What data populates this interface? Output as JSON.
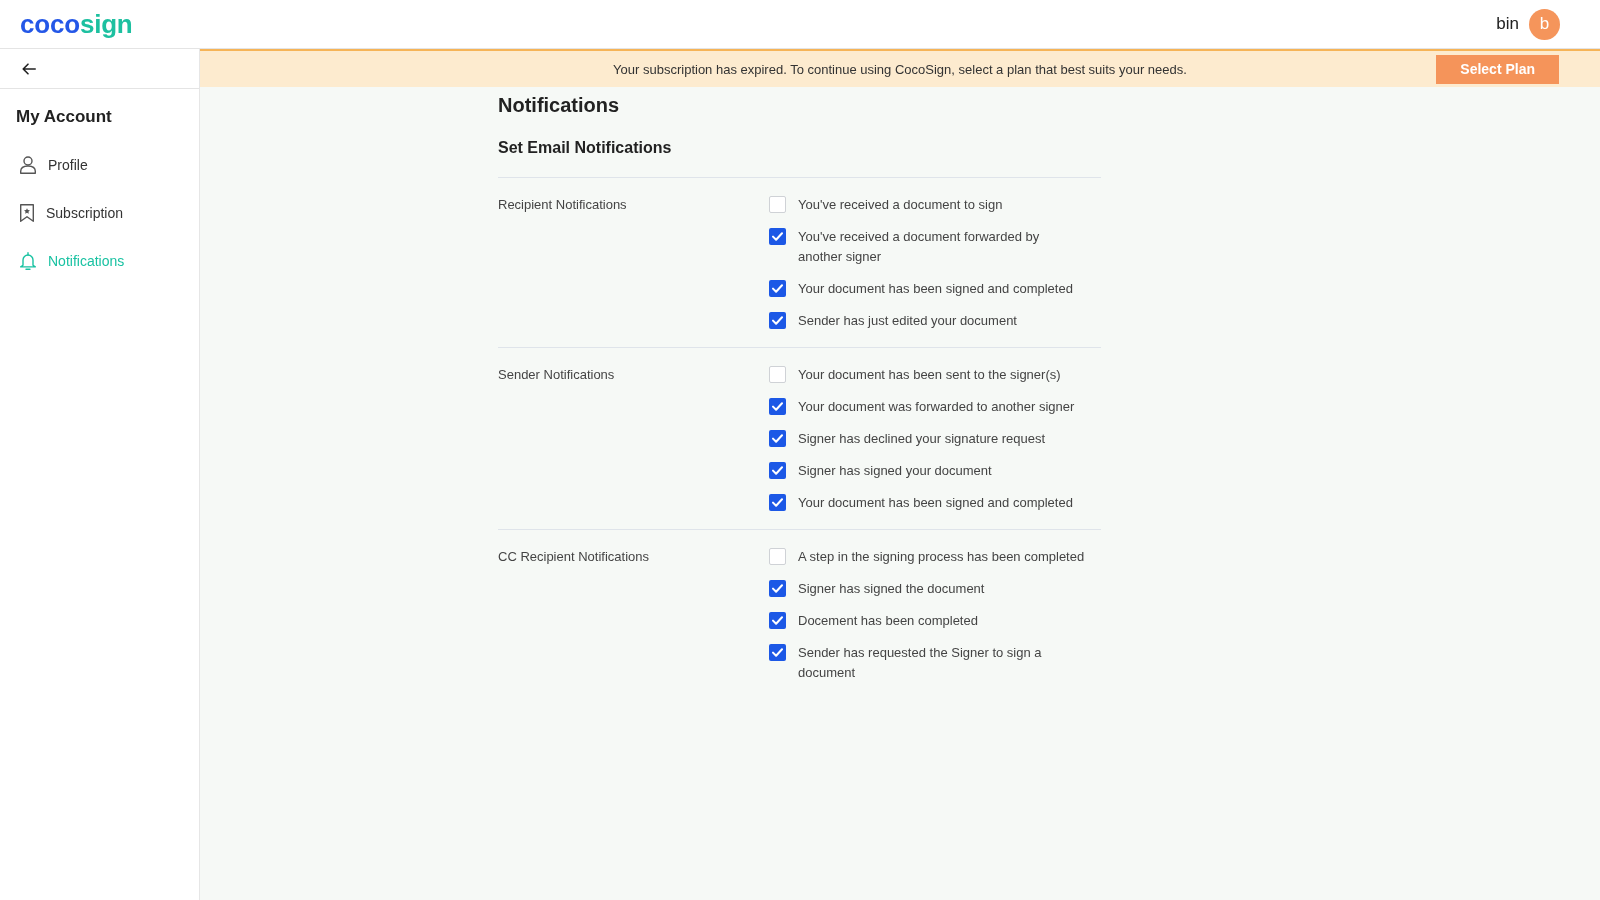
{
  "header": {
    "logo": [
      "coco",
      "sign"
    ],
    "user_name": "bin",
    "avatar_letter": "b"
  },
  "sidebar": {
    "title": "My Account",
    "items": [
      {
        "kind": "profile",
        "label": "Profile",
        "selected": false
      },
      {
        "kind": "subscription",
        "label": "Subscription",
        "selected": false
      },
      {
        "kind": "notifications",
        "label": "Notifications",
        "selected": true
      }
    ]
  },
  "banner": {
    "message": "Your subscription has expired. To continue using CocoSign, select a plan that best suits your needs.",
    "button": "Select Plan"
  },
  "page": {
    "title": "Notifications",
    "subtitle": "Set Email Notifications",
    "groups": [
      {
        "label": "Recipient Notifications",
        "options": [
          {
            "label": "You've received a document to sign",
            "checked": false
          },
          {
            "label": "You've received a document forwarded by another signer",
            "checked": true
          },
          {
            "label": "Your document has been signed and completed",
            "checked": true
          },
          {
            "label": "Sender has just edited your document",
            "checked": true
          }
        ]
      },
      {
        "label": "Sender Notifications",
        "options": [
          {
            "label": "Your document has been sent to the signer(s)",
            "checked": false
          },
          {
            "label": "Your document was forwarded to another signer",
            "checked": true
          },
          {
            "label": "Signer has declined your signature request",
            "checked": true
          },
          {
            "label": "Signer has signed your document",
            "checked": true
          },
          {
            "label": "Your document has been signed and completed",
            "checked": true
          }
        ]
      },
      {
        "label": "CC Recipient Notifications",
        "options": [
          {
            "label": "A step in the signing process has been completed",
            "checked": false
          },
          {
            "label": "Signer has signed the document",
            "checked": true
          },
          {
            "label": "Docement has been completed",
            "checked": true
          },
          {
            "label": "Sender has requested the Signer to sign a document",
            "checked": true
          }
        ]
      }
    ]
  }
}
